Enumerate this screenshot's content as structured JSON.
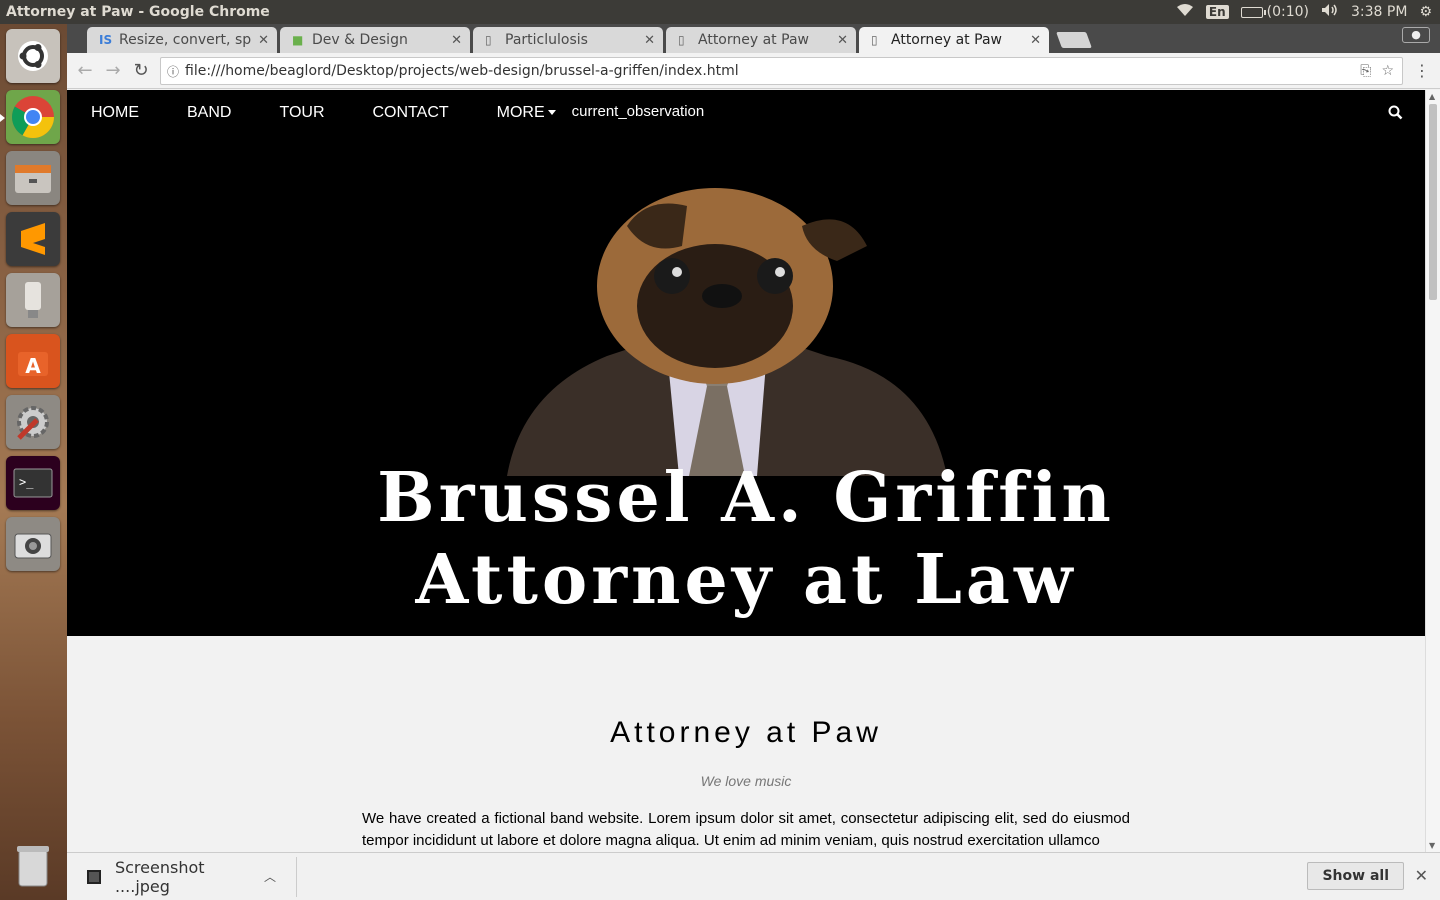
{
  "top_panel": {
    "window_title": "Attorney at Paw - Google Chrome",
    "language": "En",
    "battery": "(0:10)",
    "time": "3:38 PM"
  },
  "launcher": {
    "items": [
      "ubuntu-dash",
      "chrome",
      "files",
      "sublime-text",
      "usb-drive",
      "software-center",
      "system-settings",
      "terminal",
      "screenshot",
      "trash"
    ]
  },
  "tabs": [
    {
      "label": "Resize, convert, spl",
      "icon": "IS"
    },
    {
      "label": "Dev & Design",
      "icon": "leaf"
    },
    {
      "label": "Particlulosis",
      "icon": "doc"
    },
    {
      "label": "Attorney at Paw",
      "icon": "doc"
    },
    {
      "label": "Attorney at Paw",
      "icon": "doc",
      "active": true
    }
  ],
  "toolbar": {
    "url": "file:///home/beaglord/Desktop/projects/web-design/brussel-a-griffen/index.html"
  },
  "site": {
    "nav": {
      "home": "HOME",
      "band": "BAND",
      "tour": "TOUR",
      "contact": "CONTACT",
      "more": "MORE",
      "extra": "current_observation"
    },
    "hero": {
      "line1": "Brussel A. Griffin",
      "line2": "Attorney at Law"
    },
    "heading": "Attorney at Paw",
    "tagline": "We love music",
    "body": "We have created a fictional band website. Lorem ipsum dolor sit amet, consectetur adipiscing elit, sed do eiusmod tempor incididunt ut labore et dolore magna aliqua. Ut enim ad minim veniam, quis nostrud exercitation ullamco"
  },
  "downloads": {
    "file": "Screenshot ....jpeg",
    "show_all": "Show all"
  },
  "colors": {
    "nav_bg": "#000000",
    "page_bg": "#f2f2f2",
    "panel_bg": "#3c3b37"
  }
}
